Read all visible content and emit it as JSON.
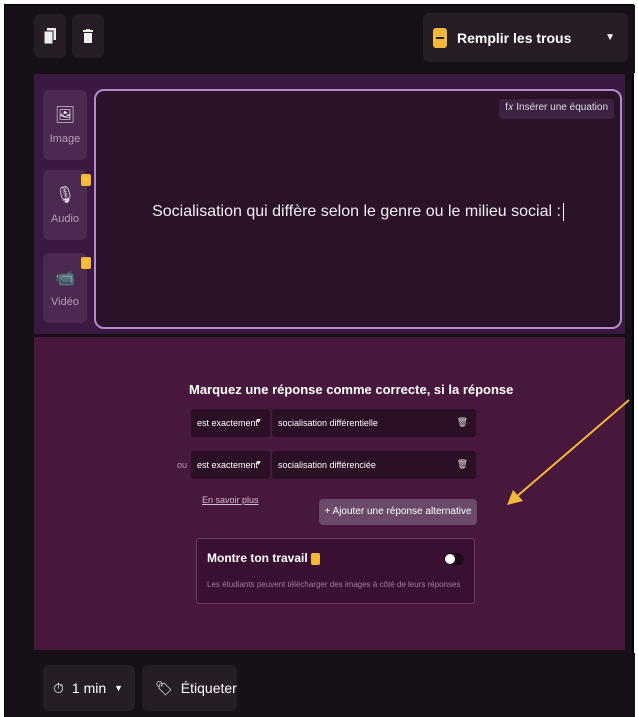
{
  "toolbar": {
    "copy_icon": "copy-icon",
    "delete_icon": "trash-icon",
    "question_type": "Remplir les trous"
  },
  "media": {
    "image_label": "Image",
    "audio_label": "Audio",
    "video_label": "Vidéo"
  },
  "editor": {
    "equation_button": "Insérer une équation",
    "equation_icon": "f𝑥",
    "question_text": "Socialisation qui diffère selon le genre ou  le milieu social :"
  },
  "answers": {
    "title": "Marquez une réponse comme correcte, si la réponse",
    "rows": [
      {
        "prefix": "",
        "condition": "est exactement",
        "value": "socialisation différentielle"
      },
      {
        "prefix": "ou",
        "condition": "est exactement",
        "value": "socialisation différenciée"
      }
    ],
    "learn_more": "En savoir plus",
    "add_alternative": "+ Ajouter une réponse alternative"
  },
  "show_work": {
    "title": "Montre ton travail",
    "description": "Les étudiants peuvent télécharger des images à côté de leurs réponses",
    "enabled": false
  },
  "bottom": {
    "timer": "1 min",
    "tag_label": "Étiqueter"
  },
  "colors": {
    "accent": "#f3b83b",
    "arrow": "#f3b83b",
    "editor_border": "#b58ad0"
  }
}
